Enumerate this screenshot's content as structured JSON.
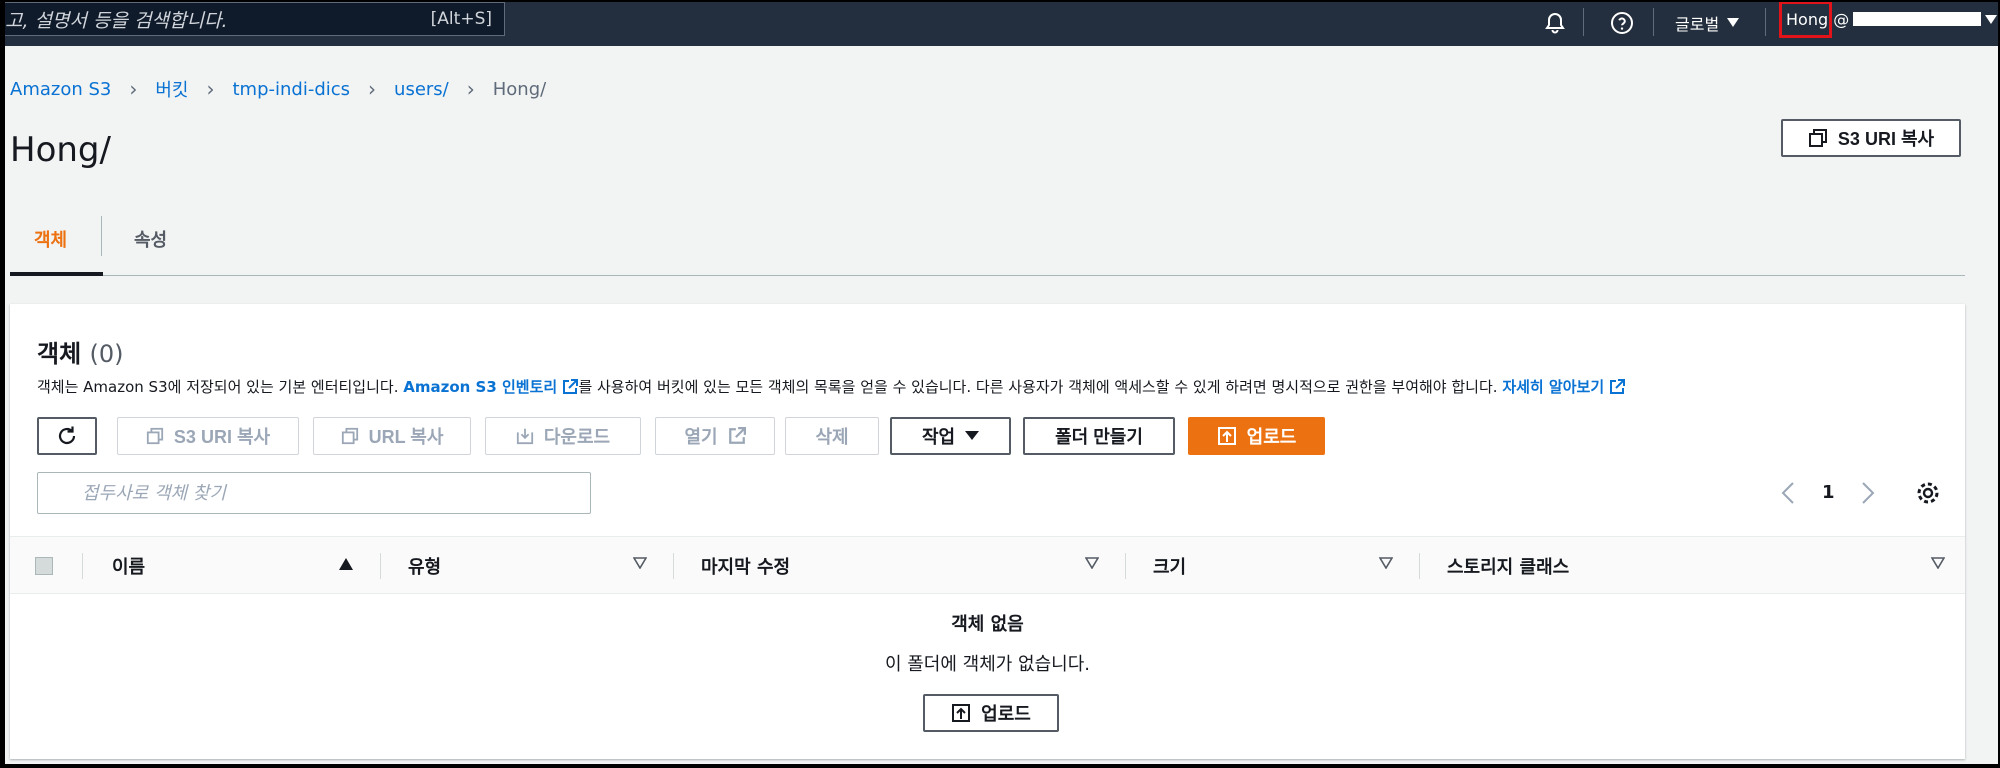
{
  "topnav": {
    "search_hint": "고, 설명서 등을 검색합니다.",
    "shortcut": "[Alt+S]",
    "region": "글로벌",
    "user": "Hong @"
  },
  "breadcrumb": {
    "items": [
      "Amazon S3",
      "버킷",
      "tmp-indi-dics",
      "users/"
    ],
    "current": "Hong/"
  },
  "page": {
    "title": "Hong/",
    "copy_uri_label": "S3 URI 복사"
  },
  "tabs": [
    {
      "label": "객체",
      "active": true
    },
    {
      "label": "속성",
      "active": false
    }
  ],
  "objects": {
    "title": "객체",
    "count": "(0)",
    "desc_part1": "객체는 Amazon S3에 저장되어 있는 기본 엔터티입니다. ",
    "desc_link1": "Amazon S3 인벤토리",
    "desc_part2": "를 사용하여 버킷에 있는 모든 객체의 목록을 얻을 수 있습니다. 다른 사용자가 객체에 액세스할 수 있게 하려면 명시적으로 권한을 부여해야 합니다. ",
    "desc_link2": "자세히 알아보기"
  },
  "actions": {
    "copy_s3_uri": "S3 URI 복사",
    "copy_url": "URL 복사",
    "download": "다운로드",
    "open": "열기",
    "delete": "삭제",
    "actions": "작업",
    "create_folder": "폴더 만들기",
    "upload": "업로드"
  },
  "search": {
    "placeholder": "접두사로 객체 찾기"
  },
  "pagination": {
    "page": "1"
  },
  "table": {
    "columns": [
      "이름",
      "유형",
      "마지막 수정",
      "크기",
      "스토리지 클래스"
    ]
  },
  "empty": {
    "title": "객체 없음",
    "subtitle": "이 폴더에 객체가 없습니다.",
    "upload": "업로드"
  },
  "colors": {
    "nav_bg": "#232f3e",
    "primary": "#ec7211",
    "link": "#0972d3",
    "highlight": "#e3131a"
  }
}
